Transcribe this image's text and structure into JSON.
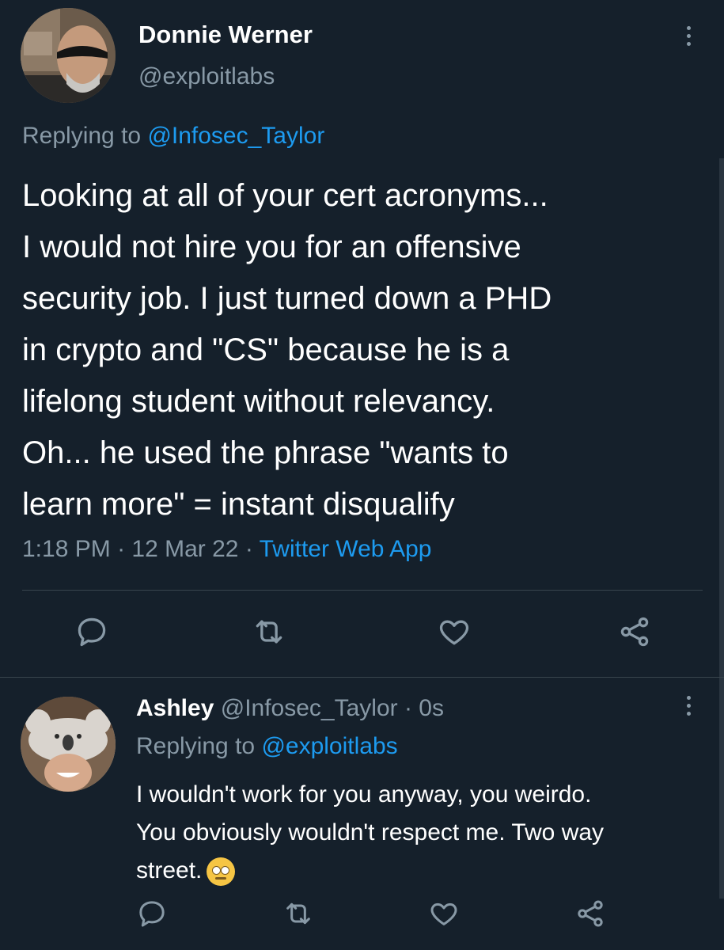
{
  "main_tweet": {
    "author_name": "Donnie Werner",
    "author_handle": "@exploitlabs",
    "replying_prefix": "Replying to ",
    "replying_to": "@Infosec_Taylor",
    "text_lines": [
      "Looking at all of your cert acronyms...",
      "I would not hire you for an offensive",
      "security job. I just turned down a PHD",
      "in crypto and \"CS\" because he is a",
      "lifelong student without relevancy.",
      "Oh... he used the phrase \"wants to",
      "learn more\" = instant disqualify"
    ],
    "time": "1:18 PM",
    "separator": " · ",
    "date": "12 Mar 22",
    "source": "Twitter Web App",
    "actions": [
      "reply-icon",
      "retweet-icon",
      "like-icon",
      "share-icon"
    ]
  },
  "reply_tweet": {
    "author_name": "Ashley",
    "author_handle": "@Infosec_Taylor",
    "separator": " · ",
    "age": "0s",
    "replying_prefix": "Replying to ",
    "replying_to": "@exploitlabs",
    "text_lines": [
      "I wouldn't work for you anyway, you weirdo.",
      "You obviously wouldn't respect me. Two way",
      "street."
    ],
    "emoji": "face-with-rolling-eyes-emoji",
    "actions": [
      "reply-icon",
      "retweet-icon",
      "like-icon",
      "share-icon"
    ]
  },
  "colors": {
    "background": "#15202b",
    "text_primary": "#ffffff",
    "text_secondary": "#8899a6",
    "link": "#1d9bf0",
    "divider": "#38444d"
  }
}
